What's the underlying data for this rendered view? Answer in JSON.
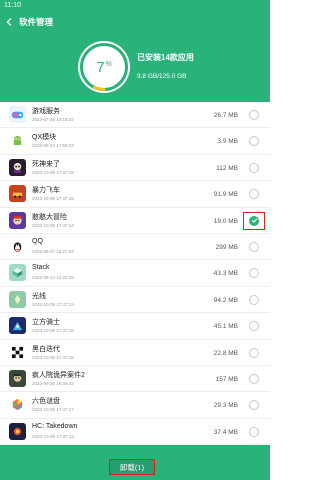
{
  "status": {
    "time": "11:10"
  },
  "header": {
    "title": "软件管理",
    "usage_percent": 7,
    "usage_num": "7",
    "usage_unit": "%",
    "installed_text": "已安装14款应用",
    "storage_text": "9.8 GB/125.0 GB"
  },
  "colors": {
    "accent": "#2ab27b",
    "highlight": "#d9261c"
  },
  "apps": [
    {
      "name": "游戏服务",
      "date": "2023-07-26 13:16:32",
      "size": "26.7 MB",
      "checked": false,
      "icon": "game-service-icon"
    },
    {
      "name": "QX模块",
      "date": "2023-08-04 17:58:03",
      "size": "3.9 MB",
      "checked": false,
      "icon": "android-robot-icon"
    },
    {
      "name": "死神来了",
      "date": "2023-10-05 17:47:19",
      "size": "112 MB",
      "checked": false,
      "icon": "reaper-game-icon"
    },
    {
      "name": "暴力飞车",
      "date": "2023-10-05 17:47:15",
      "size": "91.9 MB",
      "checked": false,
      "icon": "car-game-icon"
    },
    {
      "name": "憨憨大冒险",
      "date": "2023-10-05 17:47:14",
      "size": "19.0 MB",
      "checked": true,
      "icon": "adventure-game-icon"
    },
    {
      "name": "QQ",
      "date": "2023-08-07 15:27:04",
      "size": "299 MB",
      "checked": false,
      "icon": "qq-penguin-icon"
    },
    {
      "name": "Stack",
      "date": "2023-09-13 14:20:29",
      "size": "43.3 MB",
      "checked": false,
      "icon": "stack-blocks-icon"
    },
    {
      "name": "光线",
      "date": "2023-10-05 17:47:13",
      "size": "94.2 MB",
      "checked": false,
      "icon": "light-ray-icon"
    },
    {
      "name": "立方骑士",
      "date": "2023-10-05 17:47:18",
      "size": "45.1 MB",
      "checked": false,
      "icon": "cube-knight-icon"
    },
    {
      "name": "黑白迭代",
      "date": "2023-10-05 17:47:16",
      "size": "22.8 MB",
      "checked": false,
      "icon": "checker-pattern-icon"
    },
    {
      "name": "疯人院诡异案件2",
      "date": "2023-09-26 19:29:42",
      "size": "157 MB",
      "checked": false,
      "icon": "asylum-game-icon"
    },
    {
      "name": "六色谜盘",
      "date": "2023-10-05 17:47:17",
      "size": "29.3 MB",
      "checked": false,
      "icon": "hexagon-puzzle-icon"
    },
    {
      "name": "HC: Takedown",
      "date": "2023-10-05 17:47:13",
      "size": "37.4 MB",
      "checked": false,
      "icon": "takedown-game-icon"
    }
  ],
  "footer": {
    "uninstall_label": "卸载(1)"
  }
}
